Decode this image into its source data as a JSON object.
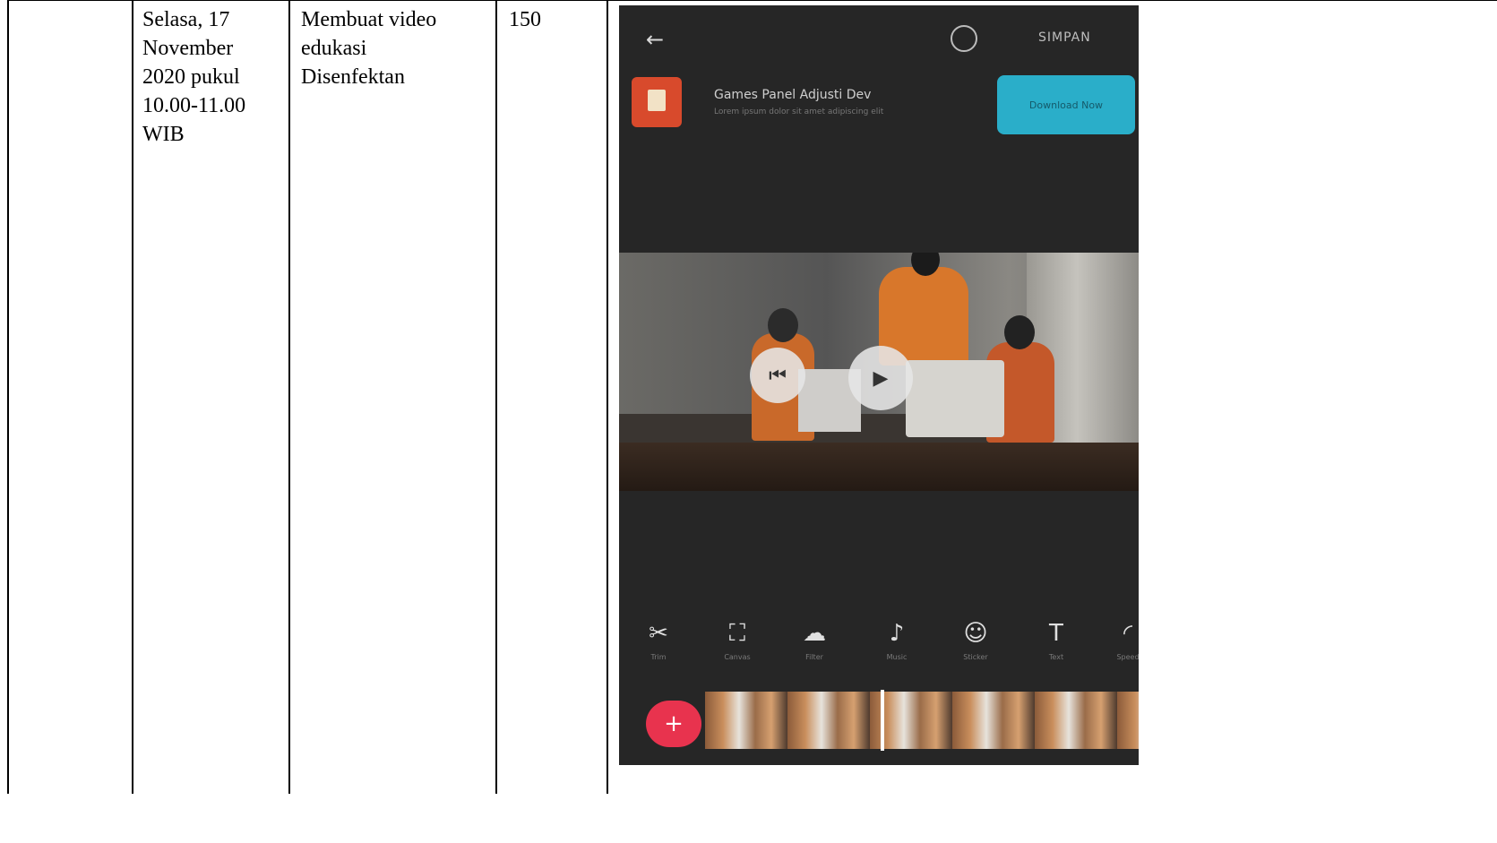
{
  "table": {
    "row": {
      "date": "Selasa,  17\nNovember\n2020 pukul\n10.00-11.00\nWIB",
      "activity": "Membuat video\nedukasi\nDisenfektan",
      "number": "150"
    }
  },
  "phone": {
    "back_icon": "arrow-left-icon",
    "save_label": "SIMPAN",
    "ad": {
      "title": "Games Panel Adjusti Dev",
      "subtitle": "Lorem ipsum dolor sit amet adipiscing elit",
      "button": "Download Now"
    },
    "toolbar": [
      {
        "icon": "scissors-icon",
        "glyph": "✂",
        "label": "Trim"
      },
      {
        "icon": "canvas-icon",
        "glyph": "⛶",
        "label": "Canvas"
      },
      {
        "icon": "filter-icon",
        "glyph": "☁",
        "label": "Filter"
      },
      {
        "icon": "music-icon",
        "glyph": "♪",
        "label": "Music"
      },
      {
        "icon": "sticker-icon",
        "glyph": "☺",
        "label": "Sticker"
      },
      {
        "icon": "text-icon",
        "glyph": "T",
        "label": "Text"
      },
      {
        "icon": "speed-icon",
        "glyph": "◜",
        "label": "Speed"
      }
    ],
    "add_button": "+"
  }
}
